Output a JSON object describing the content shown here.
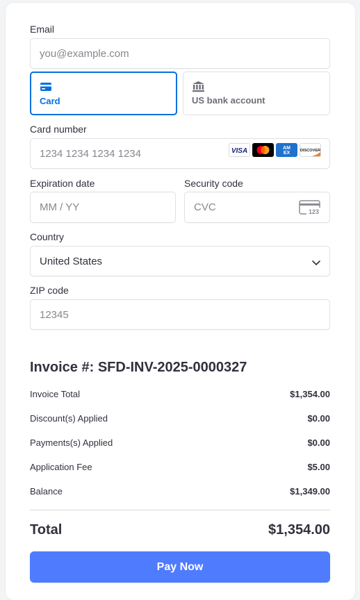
{
  "email": {
    "label": "Email",
    "placeholder": "you@example.com"
  },
  "payment_tabs": [
    {
      "label": "Card",
      "icon": "card-icon",
      "active": true
    },
    {
      "label": "US bank account",
      "icon": "bank-icon",
      "active": false
    }
  ],
  "card_number": {
    "label": "Card number",
    "placeholder": "1234 1234 1234 1234",
    "brands": [
      "VISA",
      "mastercard",
      "AMEX",
      "DISCOVER"
    ]
  },
  "expiration": {
    "label": "Expiration date",
    "placeholder": "MM / YY"
  },
  "security_code": {
    "label": "Security code",
    "placeholder": "CVC",
    "icon_text": "123"
  },
  "country": {
    "label": "Country",
    "value": "United States"
  },
  "zip": {
    "label": "ZIP code",
    "placeholder": "12345"
  },
  "invoice": {
    "title": "Invoice #: SFD-INV-2025-0000327",
    "rows": [
      {
        "label": "Invoice Total",
        "value": "$1,354.00"
      },
      {
        "label": "Discount(s) Applied",
        "value": "$0.00"
      },
      {
        "label": "Payments(s) Applied",
        "value": "$0.00"
      },
      {
        "label": "Application Fee",
        "value": "$5.00"
      },
      {
        "label": "Balance",
        "value": "$1,349.00"
      }
    ],
    "total_label": "Total",
    "total_value": "$1,354.00"
  },
  "pay_button": {
    "label": "Pay Now",
    "color": "#4f7bff"
  },
  "colors": {
    "accent": "#0570de",
    "text": "#30313d",
    "muted": "#87878f"
  }
}
